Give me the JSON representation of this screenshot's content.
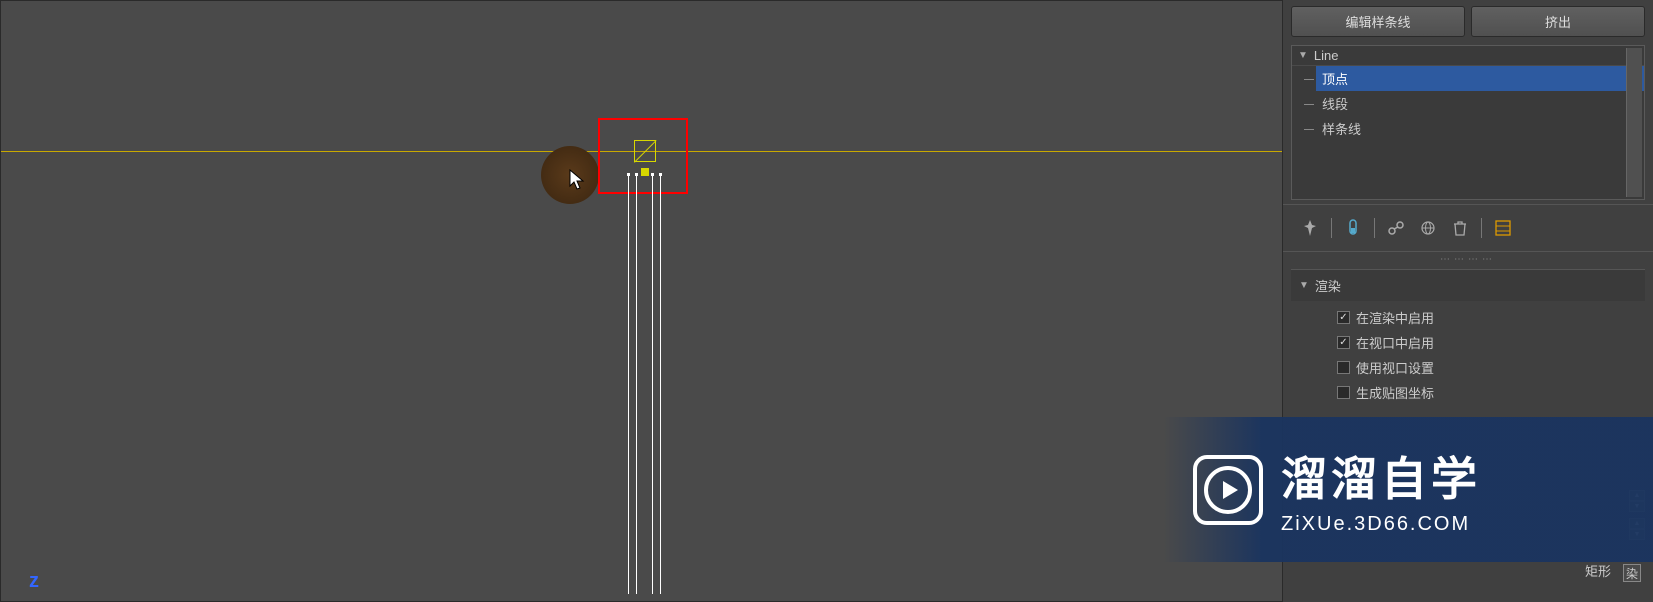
{
  "buttons": {
    "edit_spline": "编辑样条线",
    "extrude": "挤出"
  },
  "tree": {
    "root": "Line",
    "items": [
      "顶点",
      "线段",
      "样条线"
    ],
    "selected_index": 0
  },
  "toolbar_icons": {
    "pin": "pin-icon",
    "test": "test-tube-icon",
    "link": "link-icon",
    "world": "globe-icon",
    "trash": "trash-icon",
    "config": "settings-icon"
  },
  "rollout": {
    "title": "渲染",
    "options": {
      "enable_render": {
        "label": "在渲染中启用",
        "checked": true
      },
      "enable_viewport": {
        "label": "在视口中启用",
        "checked": true
      },
      "use_viewport_settings": {
        "label": "使用视口设置",
        "checked": false
      },
      "generate_mapping": {
        "label": "生成贴图坐标",
        "checked": false
      }
    }
  },
  "shape_label": "矩形",
  "expand_glyph": "染",
  "axis_label": "z",
  "watermark": {
    "title": "溜溜自学",
    "url": "ZiXUe.3D66.COM"
  }
}
